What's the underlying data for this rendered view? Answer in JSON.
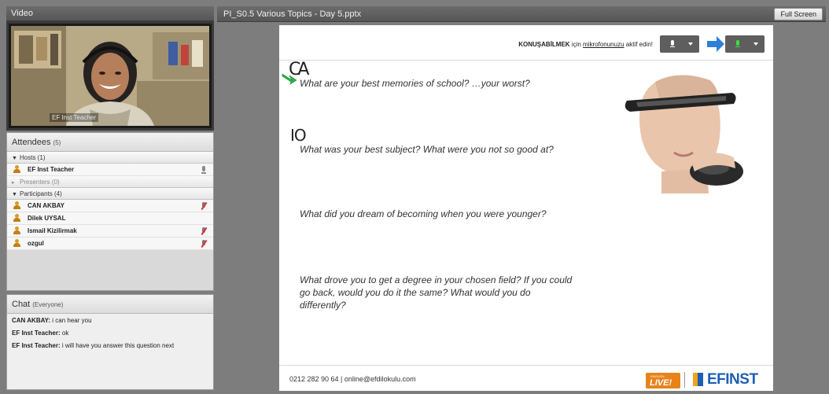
{
  "video": {
    "title": "Video",
    "cam_label": "EF Inst Teacher"
  },
  "share": {
    "title": "PI_S0.5 Various Topics - Day 5.pptx",
    "fullscreen_label": "Full Screen"
  },
  "attendees": {
    "title": "Attendees",
    "count": "(5)",
    "hosts_label": "Hosts (1)",
    "presenters_label": "Presenters (0)",
    "participants_label": "Participants (4)",
    "hosts": [
      {
        "name": "EF Inst Teacher"
      }
    ],
    "participants": [
      {
        "name": "CAN AKBAY",
        "mic": "off"
      },
      {
        "name": "Dilek UYSAL",
        "mic": "none"
      },
      {
        "name": "Ismail Kizilirmak",
        "mic": "off"
      },
      {
        "name": "ozgul",
        "mic": "off"
      }
    ]
  },
  "chat": {
    "title": "Chat",
    "scope": "(Everyone)",
    "messages": [
      {
        "sender": "CAN AKBAY:",
        "text": " i can hear you"
      },
      {
        "sender": "EF Inst Teacher:",
        "text": " ok"
      },
      {
        "sender": "EF Inst Teacher:",
        "text": " i will have you answer this question next"
      }
    ]
  },
  "slide": {
    "notice_bold": "KONUŞABİLMEK",
    "notice_mid": " için ",
    "notice_underline": "mikrofonunuzu",
    "notice_end": " aktif edin!",
    "handwriting_1": "CA",
    "handwriting_2": "IO",
    "q1": "What are your best memories of school? …your worst?",
    "q2": "What was your best subject? What were you not so good at?",
    "q3": "What did you dream of becoming when you were younger?",
    "q4_line1": "What drove you to get a degree in your chosen field? If you could",
    "q4_line2": "go back, would you do it the same? What would you do",
    "q4_line3": "differently?",
    "contact": "0212 282 90 64 | online@efdilokulu.com",
    "live_small": "ENGLISH",
    "live_big": "LIVE!",
    "brand": "EFINST"
  },
  "colors": {
    "chrome": "#565656",
    "brand_blue": "#1d5fb4",
    "brand_orange": "#e8831b",
    "mic_green": "#39e044",
    "arrow_blue": "#2f7fd8"
  }
}
